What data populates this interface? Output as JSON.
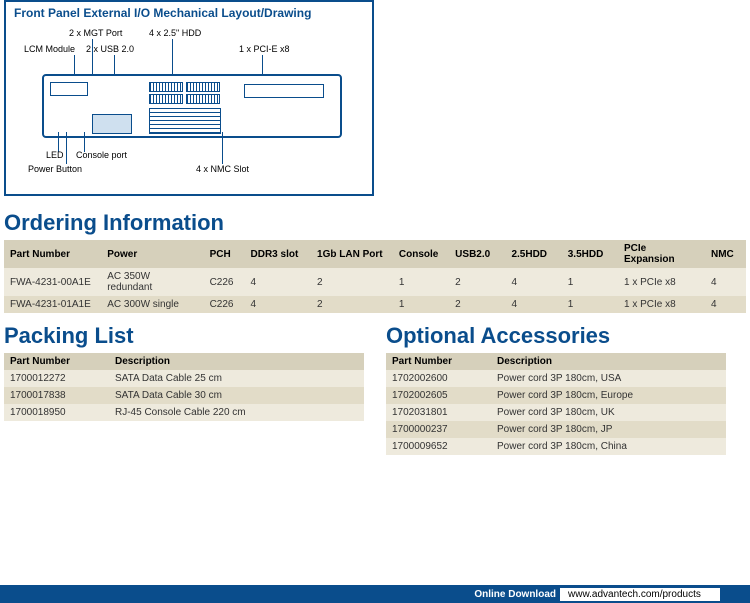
{
  "diagram": {
    "title": "Front Panel External I/O Mechanical Layout/Drawing",
    "labels": {
      "mgt": "2 x MGT Port",
      "hdd": "4 x 2.5\" HDD",
      "lcm": "LCM Module",
      "usb": "2 x USB 2.0",
      "pcie": "1 x PCI-E x8",
      "led": "LED",
      "console": "Console port",
      "power": "Power Button",
      "nmc": "4 x NMC Slot"
    }
  },
  "ordering": {
    "heading": "Ordering Information",
    "headers": [
      "Part Number",
      "Power",
      "PCH",
      "DDR3 slot",
      "1Gb LAN Port",
      "Console",
      "USB2.0",
      "2.5HDD",
      "3.5HDD",
      "PCIe Expansion",
      "NMC"
    ],
    "rows": [
      [
        "FWA-4231-00A1E",
        "AC 350W redundant",
        "C226",
        "4",
        "2",
        "1",
        "2",
        "4",
        "1",
        "1 x PCIe x8",
        "4"
      ],
      [
        "FWA-4231-01A1E",
        "AC 300W single",
        "C226",
        "4",
        "2",
        "1",
        "2",
        "4",
        "1",
        "1 x PCIe x8",
        "4"
      ]
    ]
  },
  "packing": {
    "heading": "Packing List",
    "headers": [
      "Part Number",
      "Description"
    ],
    "rows": [
      [
        "1700012272",
        "SATA Data Cable 25 cm"
      ],
      [
        "1700017838",
        "SATA Data Cable 30 cm"
      ],
      [
        "1700018950",
        "RJ-45 Console Cable 220 cm"
      ]
    ]
  },
  "accessories": {
    "heading": "Optional Accessories",
    "headers": [
      "Part Number",
      "Description"
    ],
    "rows": [
      [
        "1702002600",
        "Power cord 3P 180cm, USA"
      ],
      [
        "1702002605",
        "Power cord 3P 180cm, Europe"
      ],
      [
        "1702031801",
        "Power cord 3P 180cm, UK"
      ],
      [
        "1700000237",
        "Power cord 3P 180cm, JP"
      ],
      [
        "1700009652",
        "Power cord 3P 180cm, China"
      ]
    ]
  },
  "footer": {
    "label": "Online Download",
    "url": "www.advantech.com/products"
  }
}
